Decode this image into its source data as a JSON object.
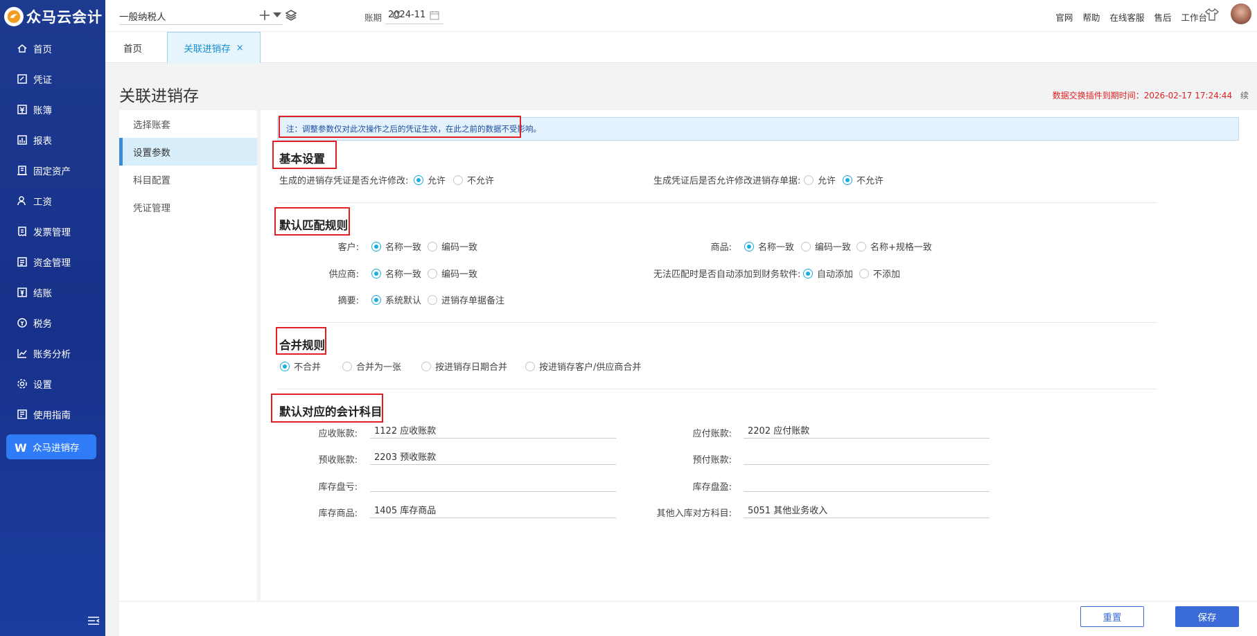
{
  "app": {
    "name": "众马云会计"
  },
  "sidebar": {
    "items": [
      {
        "label": "首页",
        "icon": "home-icon"
      },
      {
        "label": "凭证",
        "icon": "voucher-icon"
      },
      {
        "label": "账簿",
        "icon": "ledger-icon"
      },
      {
        "label": "报表",
        "icon": "report-icon"
      },
      {
        "label": "固定资产",
        "icon": "asset-icon"
      },
      {
        "label": "工资",
        "icon": "salary-icon"
      },
      {
        "label": "发票管理",
        "icon": "invoice-icon"
      },
      {
        "label": "资金管理",
        "icon": "fund-icon"
      },
      {
        "label": "结账",
        "icon": "checkout-icon"
      },
      {
        "label": "税务",
        "icon": "tax-icon"
      },
      {
        "label": "账务分析",
        "icon": "analysis-icon"
      },
      {
        "label": "设置",
        "icon": "gear-icon"
      },
      {
        "label": "使用指南",
        "icon": "guide-icon"
      }
    ],
    "special": {
      "label": "众马进销存",
      "icon": "w-logo-icon"
    }
  },
  "topbar": {
    "company": "一般纳税人",
    "period_label": "账期",
    "period_value": "2024-11",
    "links": [
      "官网",
      "帮助",
      "在线客服",
      "售后",
      "工作台"
    ]
  },
  "tabs": [
    {
      "label": "首页"
    },
    {
      "label": "关联进销存"
    }
  ],
  "page": {
    "title": "关联进销存",
    "expire": "数据交换插件到期时间：2026-02-17 17:24:44",
    "cut": "续"
  },
  "left_menu": [
    "选择账套",
    "设置参数",
    "科目配置",
    "凭证管理"
  ],
  "notice": "注：调整参数仅对此次操作之后的凭证生效，在此之前的数据不受影响。",
  "basic": {
    "title": "基本设置",
    "q1": {
      "label": "生成的进销存凭证是否允许修改:",
      "options": [
        "允许",
        "不允许"
      ]
    },
    "q2": {
      "label": "生成凭证后是否允许修改进销存单据:",
      "options": [
        "允许",
        "不允许"
      ]
    }
  },
  "match": {
    "title": "默认匹配规则",
    "customer": {
      "label": "客户:",
      "options": [
        "名称一致",
        "编码一致"
      ]
    },
    "goods": {
      "label": "商品:",
      "options": [
        "名称一致",
        "编码一致",
        "名称+规格一致"
      ]
    },
    "supplier": {
      "label": "供应商:",
      "options": [
        "名称一致",
        "编码一致"
      ]
    },
    "auto_add": {
      "label": "无法匹配时是否自动添加到财务软件:",
      "options": [
        "自动添加",
        "不添加"
      ]
    },
    "summary": {
      "label": "摘要:",
      "options": [
        "系统默认",
        "进销存单据备注"
      ]
    }
  },
  "merge": {
    "title": "合并规则",
    "options": [
      "不合并",
      "合并为一张",
      "按进销存日期合并",
      "按进销存客户/供应商合并"
    ]
  },
  "accounts": {
    "title": "默认对应的会计科目",
    "rows": [
      {
        "l_label": "应收账款:",
        "l_value": "1122 应收账款",
        "r_label": "应付账款:",
        "r_value": "2202 应付账款"
      },
      {
        "l_label": "预收账款:",
        "l_value": "2203 预收账款",
        "r_label": "预付账款:",
        "r_value": ""
      },
      {
        "l_label": "库存盘亏:",
        "l_value": "",
        "r_label": "库存盘盈:",
        "r_value": ""
      },
      {
        "l_label": "库存商品:",
        "l_value": "1405 库存商品",
        "r_label": "其他入库对方科目:",
        "r_value": "5051 其他业务收入"
      }
    ]
  },
  "buttons": {
    "reset": "重置",
    "save": "保存"
  },
  "colors": {
    "sidebar": "#1c3a8f",
    "accent": "#1aaee0",
    "primary_button": "#3a6bd6",
    "highlight_box": "#e21d24",
    "expire_text": "#e0201f"
  }
}
